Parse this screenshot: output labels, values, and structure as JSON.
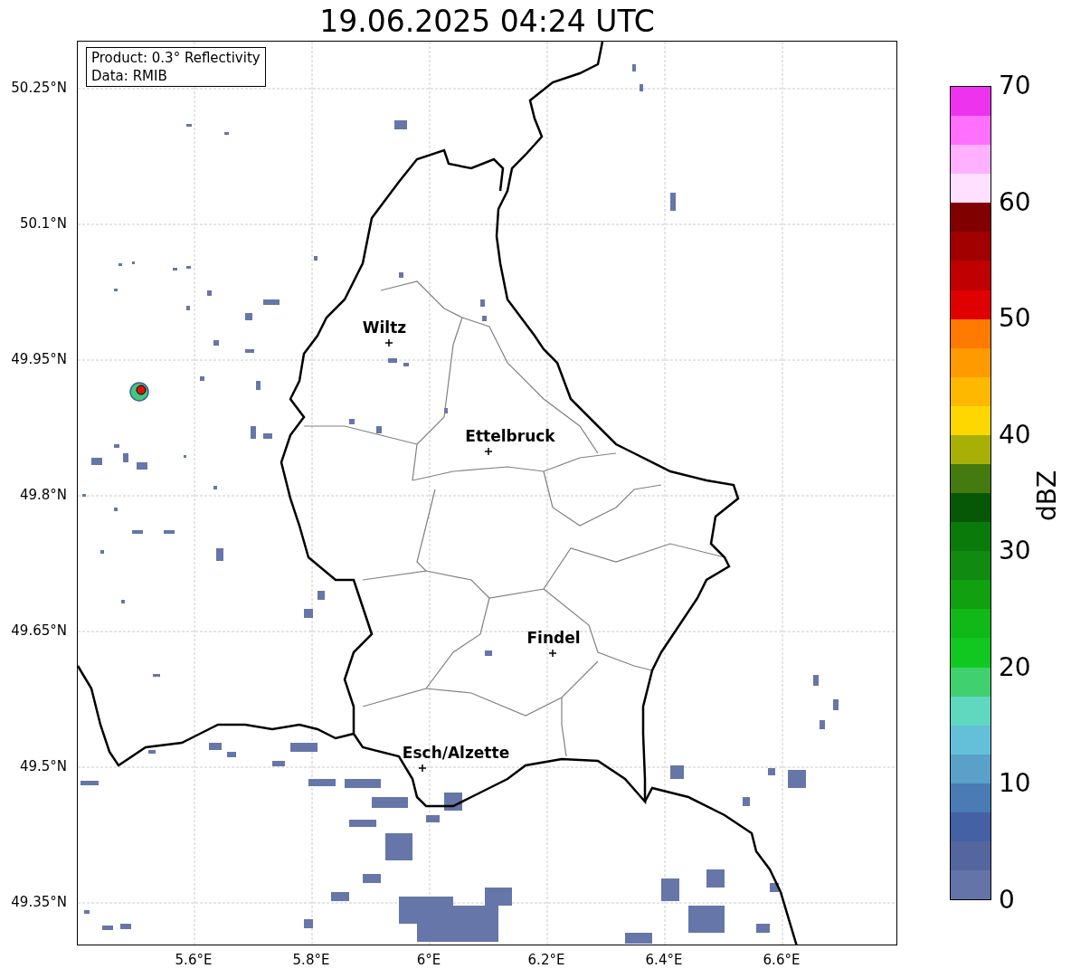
{
  "title": "19.06.2025 04:24 UTC",
  "legend": [
    "Product: 0.3° Reflectivity",
    "Data: RMIB"
  ],
  "y_ticks": [
    "50.25°N",
    "50.1°N",
    "49.95°N",
    "49.8°N",
    "49.65°N",
    "49.5°N",
    "49.35°N"
  ],
  "x_ticks": [
    "5.6°E",
    "5.8°E",
    "6°E",
    "6.2°E",
    "6.4°E",
    "6.6°E"
  ],
  "cities": [
    {
      "name": "Wiltz"
    },
    {
      "name": "Ettelbruck"
    },
    {
      "name": "Findel"
    },
    {
      "name": "Esch/Alzette"
    }
  ],
  "colorbar": {
    "label": "dBZ",
    "ticks": [
      "70",
      "60",
      "50",
      "40",
      "30",
      "20",
      "10",
      "0"
    ],
    "segments": [
      {
        "color": "#ee33ee"
      },
      {
        "color": "#ff70ff"
      },
      {
        "color": "#ffb0ff"
      },
      {
        "color": "#ffe0ff"
      },
      {
        "color": "#800000"
      },
      {
        "color": "#a00000"
      },
      {
        "color": "#c00000"
      },
      {
        "color": "#e00000"
      },
      {
        "color": "#ff7a00"
      },
      {
        "color": "#ff9a00"
      },
      {
        "color": "#ffb800"
      },
      {
        "color": "#ffd700"
      },
      {
        "color": "#a8b008"
      },
      {
        "color": "#447a10"
      },
      {
        "color": "#065806"
      },
      {
        "color": "#0a7a0a"
      },
      {
        "color": "#108a10"
      },
      {
        "color": "#10a010"
      },
      {
        "color": "#10b818"
      },
      {
        "color": "#10c820"
      },
      {
        "color": "#40d070"
      },
      {
        "color": "#60d8c0"
      },
      {
        "color": "#64c0d8"
      },
      {
        "color": "#5aa0c8"
      },
      {
        "color": "#4a7bb5"
      },
      {
        "color": "#4561a5"
      },
      {
        "color": "#55669f"
      },
      {
        "color": "#6574a8"
      }
    ]
  }
}
